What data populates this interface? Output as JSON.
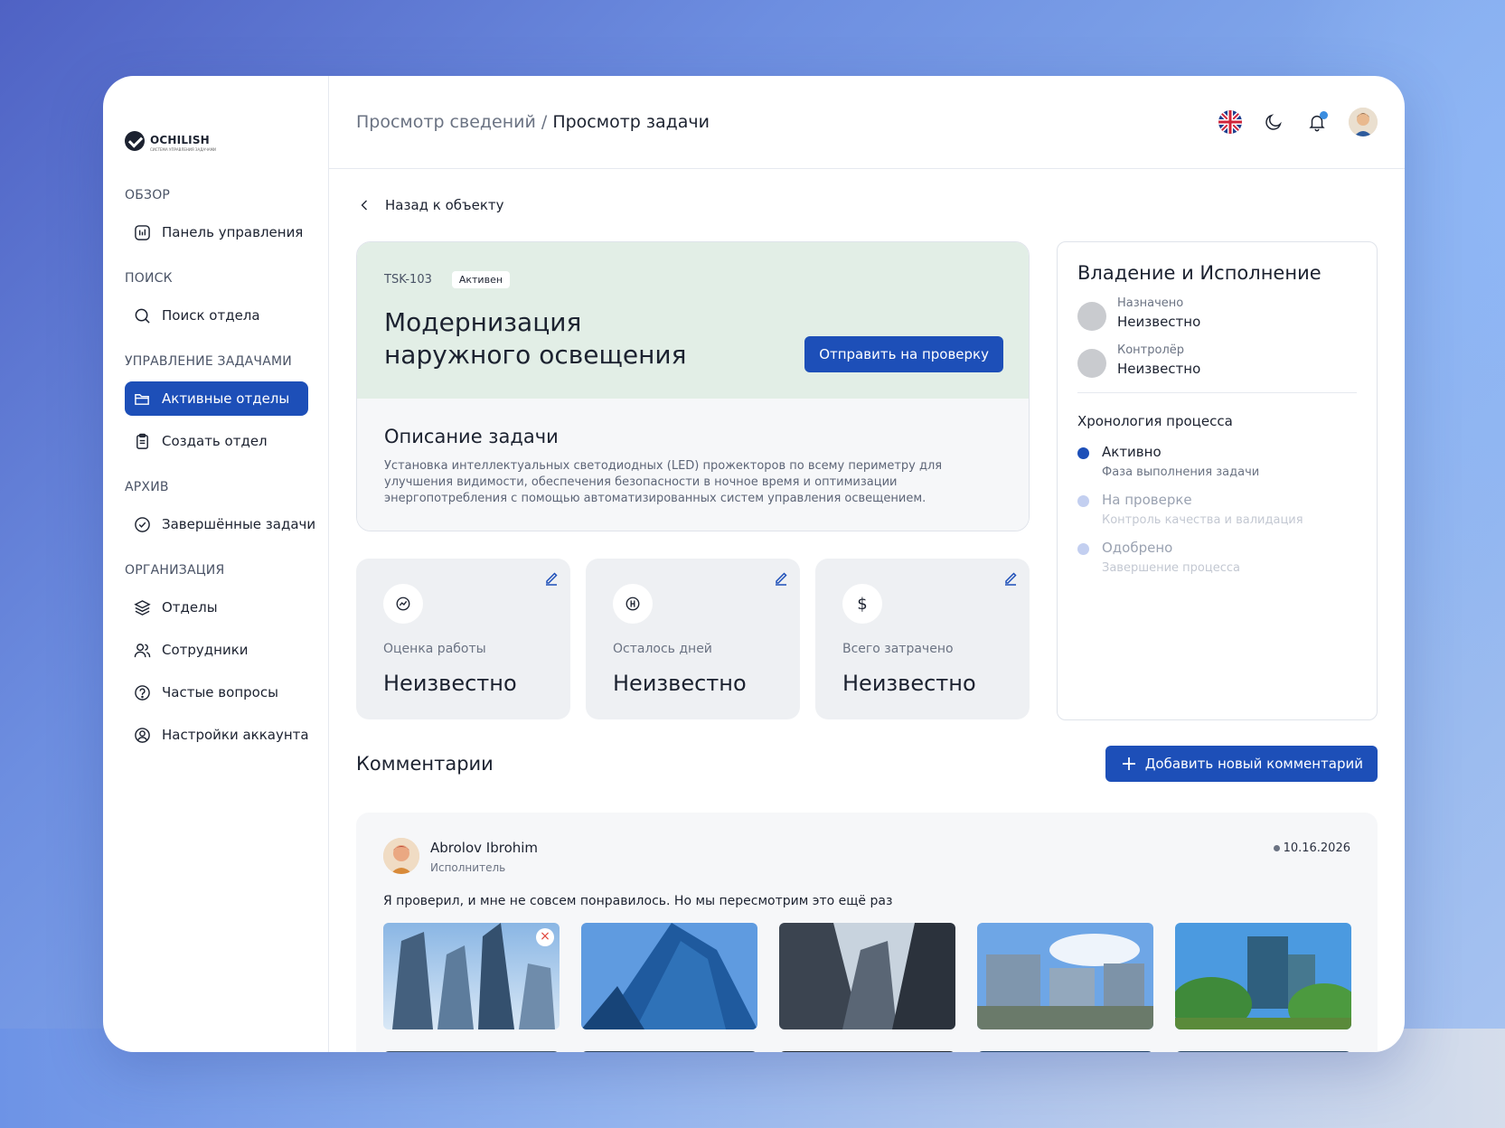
{
  "brand": {
    "name": "OCHILISH",
    "tagline": "СИСТЕМА УПРАВЛЕНИЯ ЗАДАЧАМИ"
  },
  "sidebar": {
    "sections": [
      {
        "title": "ОБЗОР",
        "items": [
          {
            "label": "Панель управления",
            "icon": "dashboard-icon"
          }
        ]
      },
      {
        "title": "ПОИСК",
        "items": [
          {
            "label": "Поиск отдела",
            "icon": "search-icon"
          }
        ]
      },
      {
        "title": "УПРАВЛЕНИЕ ЗАДАЧАМИ",
        "items": [
          {
            "label": "Активные отделы",
            "icon": "folder-icon",
            "active": true
          },
          {
            "label": "Создать отдел",
            "icon": "clipboard-icon"
          }
        ]
      },
      {
        "title": "АРХИВ",
        "items": [
          {
            "label": "Завершённые задачи",
            "icon": "check-circle-icon"
          }
        ]
      },
      {
        "title": "ОРГАНИЗАЦИЯ",
        "items": [
          {
            "label": "Отделы",
            "icon": "layers-icon"
          },
          {
            "label": "Сотрудники",
            "icon": "users-icon"
          },
          {
            "label": "Частые вопросы",
            "icon": "help-icon"
          },
          {
            "label": "Настройки аккаунта",
            "icon": "user-settings-icon"
          }
        ]
      }
    ]
  },
  "header": {
    "breadcrumb_parent": "Просмотр сведений",
    "separator": "/",
    "breadcrumb_current": "Просмотр задачи"
  },
  "back_label": "Назад к объекту",
  "task": {
    "id": "TSK-103",
    "status": "Активен",
    "title_line1": "Модернизация",
    "title_line2": "наружного освещения",
    "submit_label": "Отправить на проверку",
    "description_title": "Описание задачи",
    "description": "Установка интеллектуальных светодиодных (LED) прожекторов по всему периметру для улучшения видимости, обеспечения безопасности в ночное время и оптимизации энергопотребления с помощью автоматизированных систем управления освещением."
  },
  "stats": [
    {
      "label": "Оценка работы",
      "value": "Неизвестно",
      "icon": "gauge-icon"
    },
    {
      "label": "Осталось дней",
      "value": "Неизвестно",
      "icon": "timer-icon"
    },
    {
      "label": "Всего затрачено",
      "value": "Неизвестно",
      "icon": "dollar-icon",
      "glyph": "$"
    }
  ],
  "ownership": {
    "title": "Владение и Исполнение",
    "assigned_label": "Назначено",
    "assigned_value": "Неизвестно",
    "controller_label": "Контролёр",
    "controller_value": "Неизвестно",
    "timeline_title": "Хронология процесса",
    "timeline": [
      {
        "name": "Активно",
        "sub": "Фаза выполнения задачи",
        "color": "#1d4fb8"
      },
      {
        "name": "На проверке",
        "sub": "Контроль качества и валидация",
        "color": "#c3cff0"
      },
      {
        "name": "Одобрено",
        "sub": "Завершение процесса",
        "color": "#c3cff0"
      }
    ]
  },
  "comments": {
    "title": "Комментарии",
    "add_label": "Добавить новый комментарий",
    "items": [
      {
        "author": "Abrolov Ibrohim",
        "role": "Исполнитель",
        "date": "10.16.2026",
        "text": "Я проверил, и мне не совсем понравилось. Но мы пересмотрим это ещё раз"
      }
    ]
  },
  "colors": {
    "accent": "#1d4fb8",
    "task_header_bg": "#e2eee6"
  }
}
